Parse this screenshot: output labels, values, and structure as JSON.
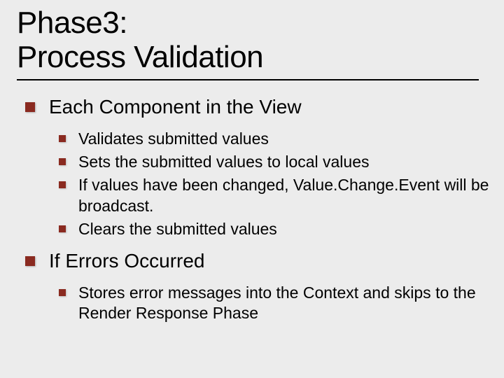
{
  "title_line1": "Phase3:",
  "title_line2": "Process Validation",
  "sections": [
    {
      "label": "Each Component in the View",
      "items": [
        "Validates submitted values",
        "Sets the submitted values to local values",
        "If values have been changed, Value.Change.Event will be broadcast.",
        "Clears the submitted values"
      ]
    },
    {
      "label": "If Errors Occurred",
      "items": [
        "Stores error messages into the Context and skips to the Render Response Phase"
      ]
    }
  ]
}
